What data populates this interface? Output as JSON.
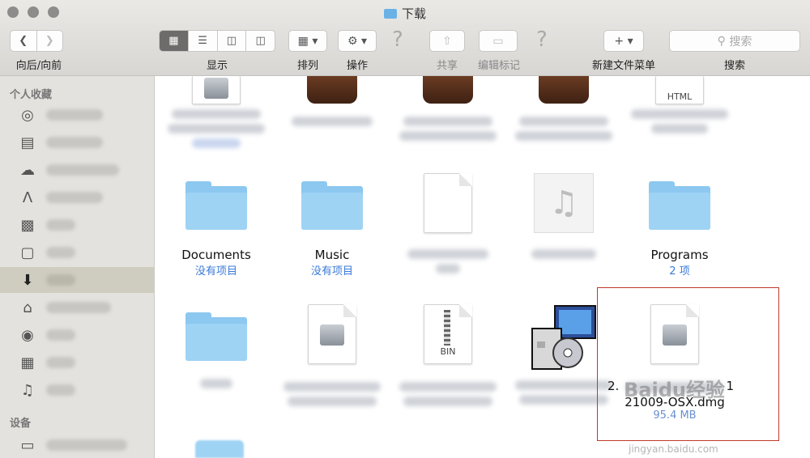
{
  "window": {
    "title": "下载"
  },
  "toolbar": {
    "nav_label": "向后/向前",
    "view_label": "显示",
    "arrange_label": "排列",
    "action_label": "操作",
    "share_label": "共享",
    "edit_tags_label": "编辑标记",
    "new_folder_menu_label": "新建文件菜单",
    "search_label": "搜索",
    "search_placeholder": "搜索"
  },
  "sidebar": {
    "favorites_header": "个人收藏",
    "devices_header": "设备",
    "items": [
      {
        "icon": "airdrop-icon"
      },
      {
        "icon": "all-files-icon"
      },
      {
        "icon": "icloud-icon"
      },
      {
        "icon": "applications-icon"
      },
      {
        "icon": "desktop-icon"
      },
      {
        "icon": "documents-icon"
      },
      {
        "icon": "downloads-icon",
        "selected": true
      },
      {
        "icon": "home-icon"
      },
      {
        "icon": "pictures-icon"
      },
      {
        "icon": "movies-icon"
      },
      {
        "icon": "music-icon"
      }
    ]
  },
  "files": {
    "documents": {
      "name": "Documents",
      "sub": "没有项目"
    },
    "music": {
      "name": "Music",
      "sub": "没有项目"
    },
    "programs": {
      "name": "Programs",
      "sub": "2 项"
    },
    "html_label": "HTML",
    "bin_label": "BIN",
    "selected_file": {
      "name_line1": "2.",
      "name_line1_end": "1",
      "name_line2": "21009-OSX.dmg",
      "size": "95.4 MB"
    }
  },
  "watermark": {
    "brand": "Baidu经验",
    "url": "jingyan.baidu.com"
  }
}
